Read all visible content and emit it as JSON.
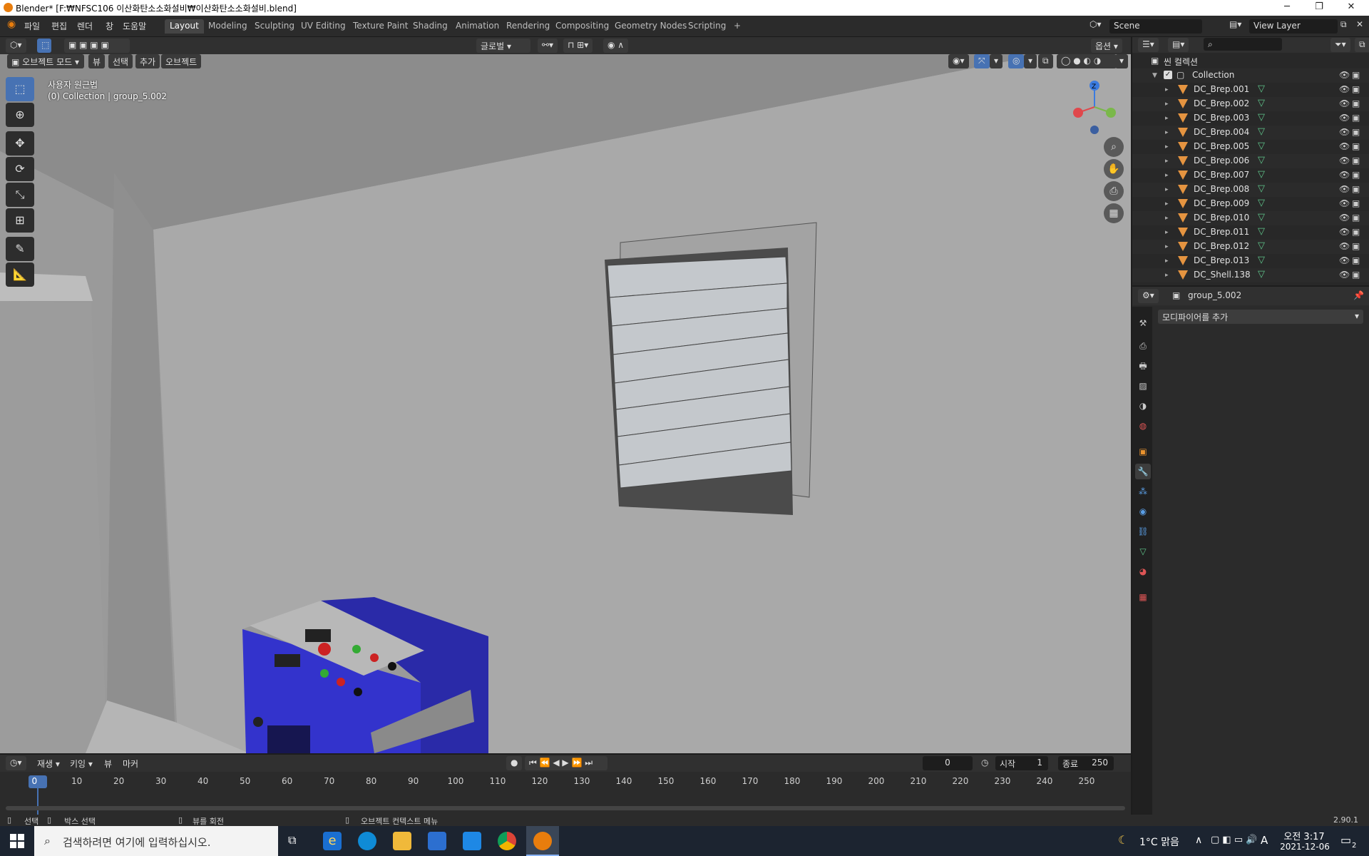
{
  "window": {
    "title": "Blender* [F:₩NFSC106 이산화탄소소화설비₩이산화탄소소화설비.blend]"
  },
  "menu": [
    "파일",
    "편집",
    "렌더",
    "창",
    "도움말"
  ],
  "workspaces": [
    {
      "label": "Layout",
      "active": true
    },
    {
      "label": "Modeling"
    },
    {
      "label": "Sculpting"
    },
    {
      "label": "UV Editing"
    },
    {
      "label": "Texture Paint"
    },
    {
      "label": "Shading"
    },
    {
      "label": "Animation"
    },
    {
      "label": "Rendering"
    },
    {
      "label": "Compositing"
    },
    {
      "label": "Geometry Nodes"
    },
    {
      "label": "Scripting"
    },
    {
      "label": "+"
    }
  ],
  "scene": {
    "name": "Scene",
    "view_layer": "View Layer"
  },
  "viewport_header": {
    "mode": "오브젝트 모드",
    "menus": [
      "뷰",
      "선택",
      "추가",
      "오브젝트"
    ],
    "transform": "글로벌",
    "options": "옵션"
  },
  "viewport": {
    "view_name": "사용자 원근법",
    "collection_info": "(0) Collection | group_5.002"
  },
  "outliner": {
    "root": "씬 컬렉션",
    "collection": "Collection",
    "items": [
      "DC_Brep.001",
      "DC_Brep.002",
      "DC_Brep.003",
      "DC_Brep.004",
      "DC_Brep.005",
      "DC_Brep.006",
      "DC_Brep.007",
      "DC_Brep.008",
      "DC_Brep.009",
      "DC_Brep.010",
      "DC_Brep.011",
      "DC_Brep.012",
      "DC_Brep.013",
      "DC_Shell.138"
    ]
  },
  "properties": {
    "object_name": "group_5.002",
    "add_modifier": "모디파이어를 추가"
  },
  "timeline": {
    "menus": [
      "재생",
      "키잉",
      "뷰",
      "마커"
    ],
    "current_frame": "0",
    "start_label": "시작",
    "start": "1",
    "end_label": "종료",
    "end": "250",
    "ticks": [
      "0",
      "10",
      "20",
      "30",
      "40",
      "50",
      "60",
      "70",
      "80",
      "90",
      "100",
      "110",
      "120",
      "130",
      "140",
      "150",
      "160",
      "170",
      "180",
      "190",
      "200",
      "210",
      "220",
      "230",
      "240",
      "250"
    ]
  },
  "status": {
    "select": "선택",
    "box_select": "박스 선택",
    "rotate_view": "뷰를 회전",
    "context_menu": "오브젝트 컨텍스트 메뉴",
    "version": "2.90.1"
  },
  "taskbar": {
    "search_placeholder": "검색하려면 여기에 입력하십시오.",
    "weather": "1°C 맑음",
    "ime": "A",
    "time": "오전 3:17",
    "date": "2021-12-06",
    "notifications": "2"
  }
}
